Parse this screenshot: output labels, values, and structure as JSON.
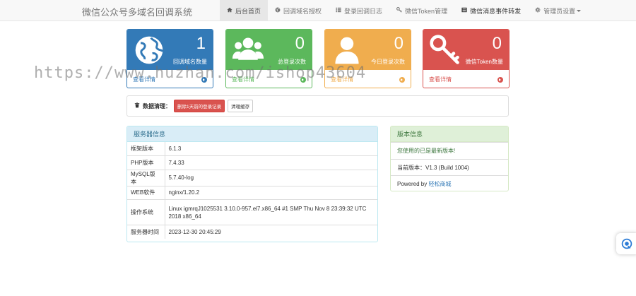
{
  "brand": "微信公众号多域名回调系统",
  "nav": [
    {
      "label": "后台首页",
      "icon": "home-icon",
      "active": true
    },
    {
      "label": "回调域名授权",
      "icon": "globe-icon"
    },
    {
      "label": "登录回调日志",
      "icon": "list-icon"
    },
    {
      "label": "微信Token管理",
      "icon": "key-icon"
    },
    {
      "label": "微信消息事件转发",
      "icon": "list-alt-icon"
    },
    {
      "label": "管理员设置",
      "icon": "cog-icon"
    }
  ],
  "cards": [
    {
      "value": "1",
      "label": "回调域名数量",
      "link": "查看详情",
      "color": "#337ab7"
    },
    {
      "value": "0",
      "label": "总登录次数",
      "link": "查看详情",
      "color": "#5cb85c"
    },
    {
      "value": "0",
      "label": "今日登录次数",
      "link": "查看详情",
      "color": "#f0ad4e"
    },
    {
      "value": "0",
      "label": "微信Token数量",
      "link": "查看详情",
      "color": "#d9534f"
    }
  ],
  "cleanup": {
    "title": "数据清理：",
    "delete_btn": "删除1天前的登录记录",
    "cache_btn": "清理缓存"
  },
  "server": {
    "title": "服务器信息",
    "rows": [
      {
        "k": "框架版本",
        "v": "6.1.3"
      },
      {
        "k": "PHP版本",
        "v": "7.4.33"
      },
      {
        "k": "MySQL版本",
        "v": "5.7.40-log"
      },
      {
        "k": "WEB软件",
        "v": "nginx/1.20.2"
      },
      {
        "k": "操作系统",
        "v": "Linux igmrqJ1025531 3.10.0-957.el7.x86_64 #1 SMP Thu Nov 8 23:39:32 UTC 2018 x86_64"
      },
      {
        "k": "服务器时间",
        "v": "2023-12-30 20:45:29"
      }
    ]
  },
  "version": {
    "title": "版本信息",
    "latest": "您使用的已是最新版本!",
    "current": "当前版本：V1.3 (Build 1004)",
    "powered_prefix": "Powered by ",
    "powered_link": "轻松商城"
  },
  "watermark": "https://www.huzhan.com/ishop43604",
  "colors": {
    "primary": "#337ab7",
    "success": "#5cb85c",
    "warning": "#f0ad4e",
    "danger": "#d9534f"
  }
}
